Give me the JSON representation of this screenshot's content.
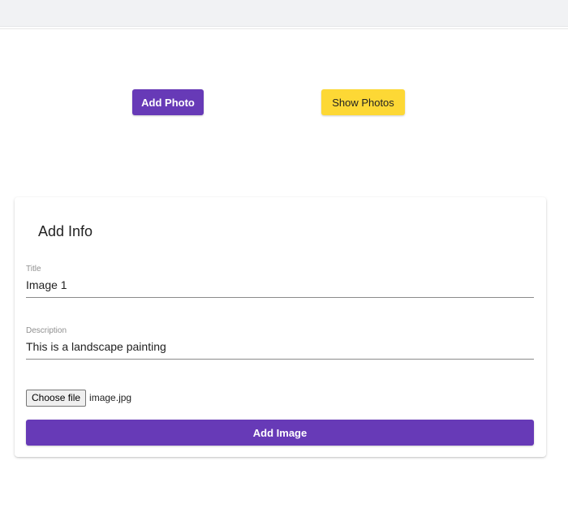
{
  "header": {
    "add_photo_label": "Add Photo",
    "show_photos_label": "Show Photos"
  },
  "form": {
    "title": "Add Info",
    "title_field": {
      "label": "Title",
      "value": "Image 1"
    },
    "description_field": {
      "label": "Description",
      "value": "This is a landscape painting"
    },
    "file": {
      "button_label": "Choose file",
      "file_name": "image.jpg"
    },
    "submit_label": "Add Image"
  },
  "colors": {
    "primary": "#673ab7",
    "accent": "#fdd835"
  }
}
